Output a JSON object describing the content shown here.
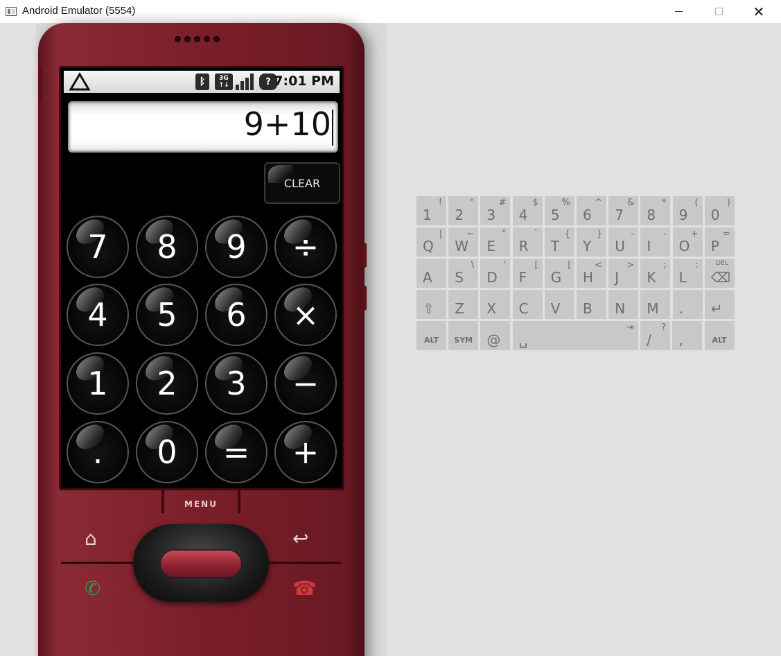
{
  "window": {
    "title": "Android Emulator (5554)",
    "minimize_glyph": "",
    "close_glyph": "✕"
  },
  "statusbar": {
    "warning_icon": "⚠",
    "bluetooth_glyph": "ᛒ",
    "network_label": "3G",
    "network_sub": "↑↓",
    "help_glyph": "?",
    "time": "7:01 PM",
    "icons": [
      "warning-icon",
      "bluetooth-icon",
      "3g-icon",
      "signal-icon",
      "help-icon"
    ]
  },
  "calculator": {
    "display": "9+10",
    "clear_label": "CLEAR",
    "keys": [
      "7",
      "8",
      "9",
      "÷",
      "4",
      "5",
      "6",
      "×",
      "1",
      "2",
      "3",
      "−",
      ".",
      "0",
      "=",
      "+"
    ]
  },
  "phone": {
    "menu_label": "MENU",
    "home_glyph": "⌂",
    "back_glyph": "↩",
    "call_glyph": "✆",
    "end_glyph": "☎",
    "colors": {
      "body": "#7a1f2a",
      "call": "#2e9a4a",
      "end": "#d03a3a"
    }
  },
  "keyboard": {
    "rows": [
      [
        {
          "m": "1",
          "a": "!"
        },
        {
          "m": "2",
          "a": "\""
        },
        {
          "m": "3",
          "a": "#"
        },
        {
          "m": "4",
          "a": "$"
        },
        {
          "m": "5",
          "a": "%"
        },
        {
          "m": "6",
          "a": "^"
        },
        {
          "m": "7",
          "a": "&"
        },
        {
          "m": "8",
          "a": "*"
        },
        {
          "m": "9",
          "a": "("
        },
        {
          "m": "0",
          "a": ")"
        }
      ],
      [
        {
          "m": "Q",
          "a": "|"
        },
        {
          "m": "W",
          "a": "~"
        },
        {
          "m": "E",
          "a": "\""
        },
        {
          "m": "R",
          "a": "`"
        },
        {
          "m": "T",
          "a": "{"
        },
        {
          "m": "Y",
          "a": "}"
        },
        {
          "m": "U",
          "a": "-"
        },
        {
          "m": "I",
          "a": "-"
        },
        {
          "m": "O",
          "a": "+"
        },
        {
          "m": "P",
          "a": "="
        }
      ],
      [
        {
          "m": "A",
          "a": ""
        },
        {
          "m": "S",
          "a": "\\"
        },
        {
          "m": "D",
          "a": "'"
        },
        {
          "m": "F",
          "a": "["
        },
        {
          "m": "G",
          "a": "]"
        },
        {
          "m": "H",
          "a": "<"
        },
        {
          "m": "J",
          "a": ">"
        },
        {
          "m": "K",
          "a": ";"
        },
        {
          "m": "L",
          "a": ":"
        },
        {
          "m": "⌫",
          "a": "DEL"
        }
      ],
      [
        {
          "m": "⇧",
          "a": ""
        },
        {
          "m": "Z",
          "a": ""
        },
        {
          "m": "X",
          "a": ""
        },
        {
          "m": "C",
          "a": ""
        },
        {
          "m": "V",
          "a": ""
        },
        {
          "m": "B",
          "a": ""
        },
        {
          "m": "N",
          "a": ""
        },
        {
          "m": "M",
          "a": ""
        },
        {
          "m": ".",
          "a": ""
        },
        {
          "m": "↵",
          "a": ""
        }
      ],
      [
        {
          "m": "ALT",
          "a": ""
        },
        {
          "m": "SYM",
          "a": ""
        },
        {
          "m": "@",
          "a": ""
        },
        {
          "m": "␣",
          "a": "⇥"
        },
        {
          "m": "/",
          "a": "?"
        },
        {
          "m": ",",
          "a": ""
        },
        {
          "m": "ALT",
          "a": ""
        }
      ]
    ]
  }
}
